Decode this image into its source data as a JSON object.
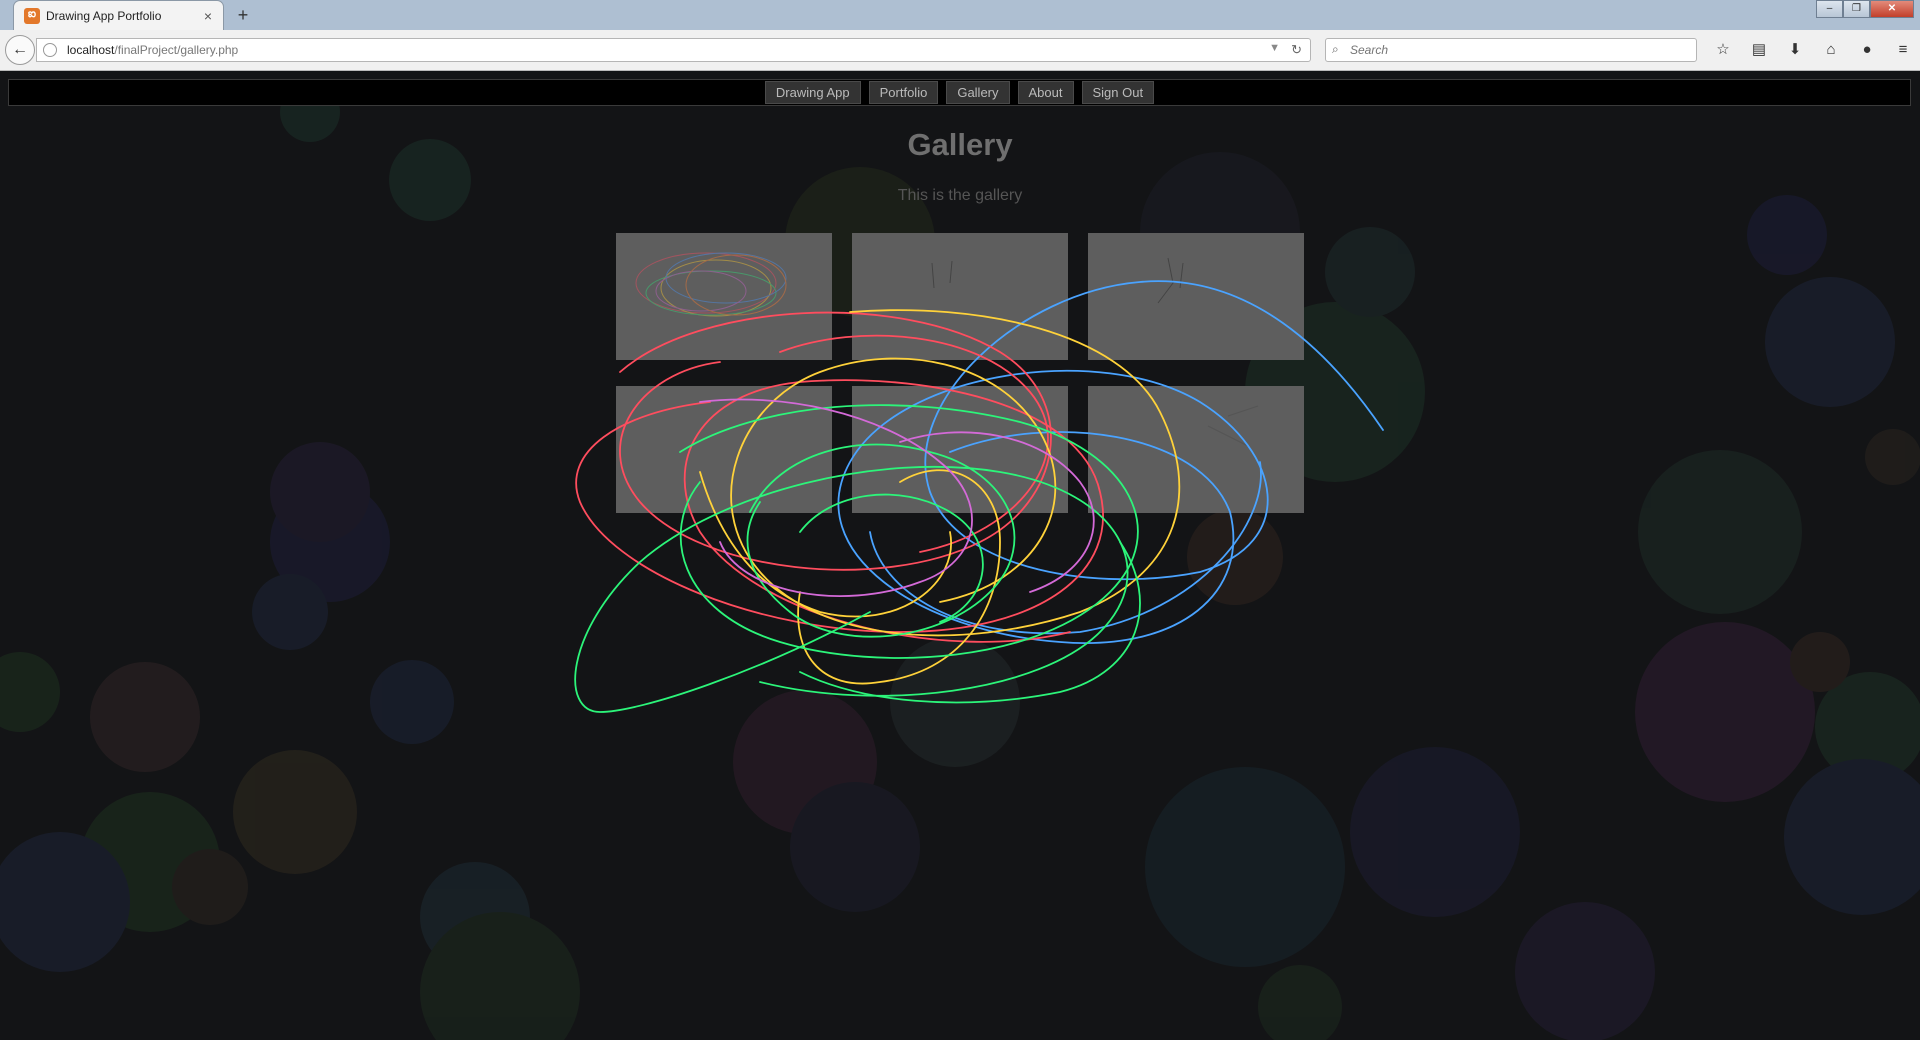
{
  "browser": {
    "tab_title": "Drawing App Portfolio",
    "tab_favicon_icon": "xampp-icon",
    "url_host": "localhost",
    "url_path": "/finalProject/gallery.php",
    "search_placeholder": "Search",
    "window_controls": [
      "minimize",
      "restore",
      "close"
    ]
  },
  "site": {
    "nav": [
      "Drawing App",
      "Portfolio",
      "Gallery",
      "About",
      "Sign Out"
    ],
    "title": "Gallery",
    "subtitle": "This is the gallery",
    "thumbnails": [
      "drawing-1",
      "drawing-2",
      "drawing-3",
      "drawing-4",
      "drawing-5",
      "drawing-6"
    ]
  },
  "colors": {
    "page_bg": "#131416",
    "thumb_bg": "#5e5e5e",
    "stroke_colors": [
      "#ff4d5e",
      "#ffd23a",
      "#2cf57a",
      "#4aa3ff",
      "#d46ad8"
    ]
  }
}
